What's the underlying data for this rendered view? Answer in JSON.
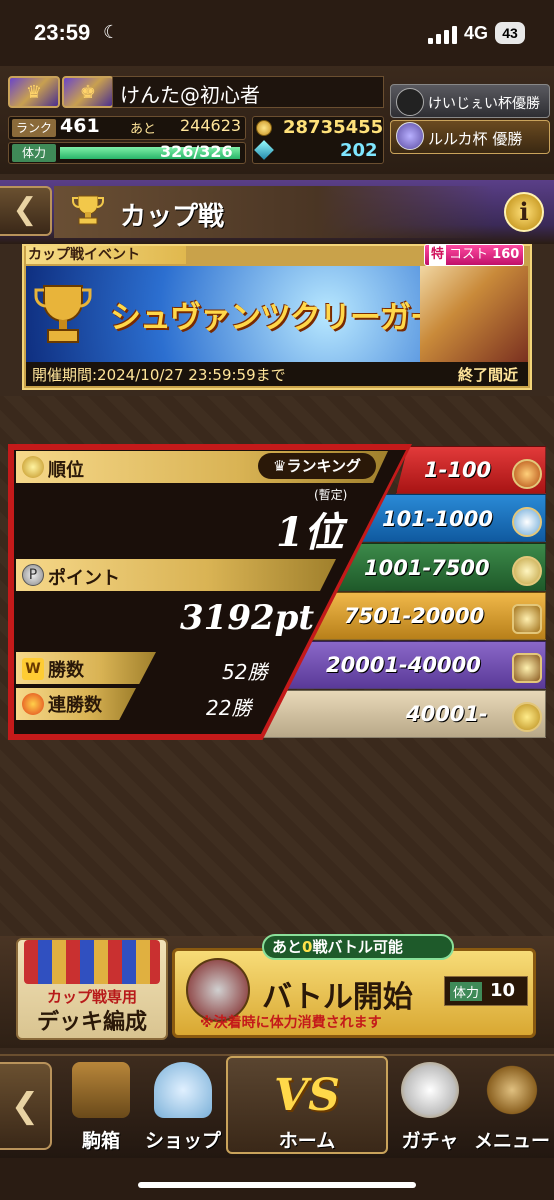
{
  "status_bar": {
    "time": "23:59",
    "network": "4G",
    "battery": "43"
  },
  "player": {
    "name": "けんた@初心者",
    "rank_label": "ランク",
    "rank": "461",
    "next_label": "あと",
    "next_exp": "244623",
    "hp_label": "体力",
    "hp_text": "326/326",
    "hp_fraction": 1.0,
    "coins": "28735455",
    "gems": "202"
  },
  "titles": [
    {
      "label": "けいじぇい杯優勝"
    },
    {
      "label": "ルルカ杯 優勝"
    }
  ],
  "page": {
    "title": "カップ戦",
    "info": "i"
  },
  "event": {
    "label": "カップ戦イベント",
    "cost_special": "特",
    "cost_label": "コスト",
    "cost_value": "160",
    "name": "シュヴァンツクリーガー杯",
    "period": "開催期間:2024/10/27 23:59:59まで",
    "status": "終了間近"
  },
  "stats": {
    "rank_label": "順位",
    "ranking_button": "ランキング",
    "rank_note": "(暫定)",
    "rank_value": "1位",
    "point_label": "ポイント",
    "point_value": "3192pt",
    "wins_label": "勝数",
    "wins_value": "52勝",
    "streak_label": "連勝数",
    "streak_value": "22勝"
  },
  "tiers": [
    {
      "range": "1-100",
      "color": "#c81e1e"
    },
    {
      "range": "101-1000",
      "color": "#1c6fbe"
    },
    {
      "range": "1001-7500",
      "color": "#2e7a3c"
    },
    {
      "range": "7501-20000",
      "color": "#d99a2a"
    },
    {
      "range": "20001-40000",
      "color": "#7452b0"
    },
    {
      "range": "40001-",
      "color": "#d4c4a0"
    }
  ],
  "actions": {
    "deck_label1": "カップ戦専用",
    "deck_label2": "デッキ編成",
    "battle_hint_prefix": "あと",
    "battle_hint_num": "0",
    "battle_hint_suffix": "戦バトル可能",
    "battle_label": "バトル開始",
    "battle_cost_label": "体力",
    "battle_cost_value": "10",
    "battle_note": "※決着時に体力消費されます"
  },
  "nav": {
    "koma": "駒箱",
    "shop": "ショップ",
    "home": "ホーム",
    "vs": "VS",
    "gacha": "ガチャ",
    "menu": "メニュー"
  }
}
